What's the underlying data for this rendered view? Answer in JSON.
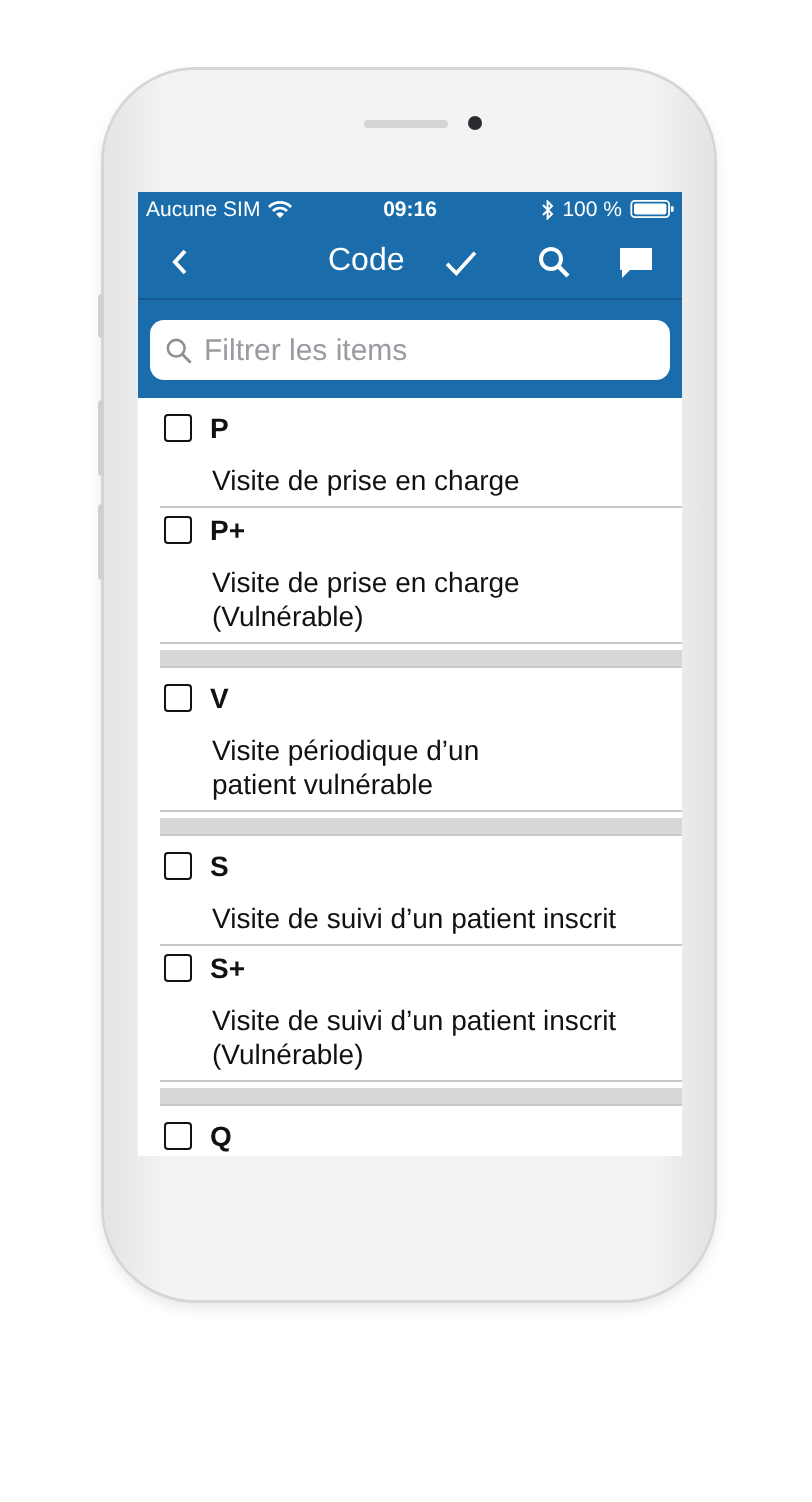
{
  "status_bar": {
    "carrier": "Aucune SIM",
    "time": "09:16",
    "battery": "100 %"
  },
  "nav_bar": {
    "title": "Code"
  },
  "search": {
    "placeholder": "Filtrer les items"
  },
  "groups": [
    {
      "items": [
        {
          "code": "P",
          "description": "Visite de prise en charge",
          "checked": false
        },
        {
          "code": "P+",
          "description": "Visite de prise en charge\n(Vulnérable)",
          "checked": false
        }
      ]
    },
    {
      "items": [
        {
          "code": "V",
          "description": "Visite périodique d’un\npatient vulnérable",
          "checked": false
        }
      ]
    },
    {
      "items": [
        {
          "code": "S",
          "description": "Visite de suivi d’un patient inscrit",
          "checked": false
        },
        {
          "code": "S+",
          "description": "Visite de suivi d’un patient inscrit\n(Vulnérable)",
          "checked": false
        }
      ]
    },
    {
      "items": [
        {
          "code": "Q",
          "checked": false
        }
      ]
    }
  ]
}
